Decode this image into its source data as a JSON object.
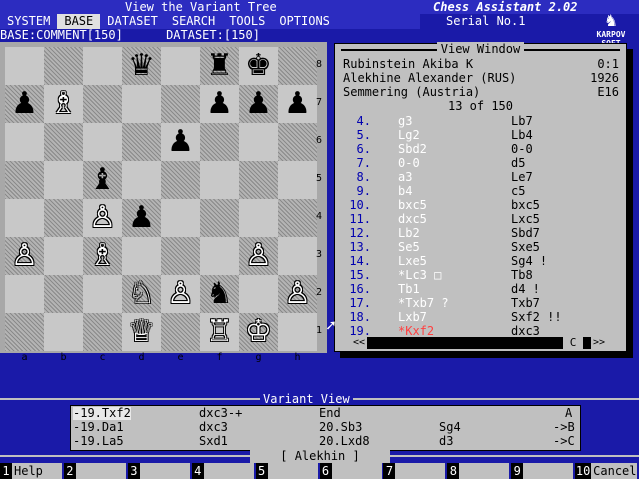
{
  "app": {
    "title": "View the Variant Tree",
    "product": "Chess Assistant 2.02",
    "serial": "Serial No.1",
    "logo_line1": "KARPOV",
    "logo_line2": "SOFT"
  },
  "menu": [
    "SYSTEM",
    "BASE",
    "DATASET",
    "SEARCH",
    "TOOLS",
    "OPTIONS"
  ],
  "menu_active": "BASE",
  "subheader": {
    "base": "BASE:COMMENT[150]",
    "dataset": "DATASET:[150]"
  },
  "board": {
    "files": [
      "a",
      "b",
      "c",
      "d",
      "e",
      "f",
      "g",
      "h"
    ],
    "ranks": [
      "8",
      "7",
      "6",
      "5",
      "4",
      "3",
      "2",
      "1"
    ],
    "pieces": [
      {
        "sq": "d8",
        "p": "♛",
        "c": "b"
      },
      {
        "sq": "f8",
        "p": "♜",
        "c": "b"
      },
      {
        "sq": "g8",
        "p": "♚",
        "c": "b"
      },
      {
        "sq": "a7",
        "p": "♟",
        "c": "b"
      },
      {
        "sq": "b7",
        "p": "♗",
        "c": "w"
      },
      {
        "sq": "f7",
        "p": "♟",
        "c": "b"
      },
      {
        "sq": "g7",
        "p": "♟",
        "c": "b"
      },
      {
        "sq": "h7",
        "p": "♟",
        "c": "b"
      },
      {
        "sq": "e6",
        "p": "♟",
        "c": "b"
      },
      {
        "sq": "c5",
        "p": "♝",
        "c": "b"
      },
      {
        "sq": "c4",
        "p": "♙",
        "c": "w"
      },
      {
        "sq": "d4",
        "p": "♟",
        "c": "b"
      },
      {
        "sq": "a3",
        "p": "♙",
        "c": "w"
      },
      {
        "sq": "c3",
        "p": "♗",
        "c": "w"
      },
      {
        "sq": "g3",
        "p": "♙",
        "c": "w"
      },
      {
        "sq": "d2",
        "p": "♘",
        "c": "w"
      },
      {
        "sq": "e2",
        "p": "♙",
        "c": "w"
      },
      {
        "sq": "f2",
        "p": "♞",
        "c": "b"
      },
      {
        "sq": "h2",
        "p": "♙",
        "c": "w"
      },
      {
        "sq": "d1",
        "p": "♕",
        "c": "w"
      },
      {
        "sq": "f1",
        "p": "♖",
        "c": "w"
      },
      {
        "sq": "g1",
        "p": "♔",
        "c": "w"
      }
    ]
  },
  "view_window": {
    "title": "View Window",
    "white": "Rubinstein Akiba K",
    "result": "0:1",
    "black": "Alekhine Alexander (RUS)",
    "year": "1926",
    "event": "Semmering (Austria)",
    "eco": "E16",
    "counter": "13 of 150",
    "moves": [
      {
        "n": "4.",
        "w": "g3",
        "b": "Lb7"
      },
      {
        "n": "5.",
        "w": "Lg2",
        "b": "Lb4"
      },
      {
        "n": "6.",
        "w": "Sbd2",
        "b": "0-0"
      },
      {
        "n": "7.",
        "w": "0-0",
        "b": "d5"
      },
      {
        "n": "8.",
        "w": "a3",
        "b": "Le7"
      },
      {
        "n": "9.",
        "w": "b4",
        "b": "c5"
      },
      {
        "n": "10.",
        "w": "bxc5",
        "b": "bxc5"
      },
      {
        "n": "11.",
        "w": "dxc5",
        "b": "Lxc5"
      },
      {
        "n": "12.",
        "w": "Lb2",
        "b": "Sbd7"
      },
      {
        "n": "13.",
        "w": "Se5",
        "b": "Sxe5"
      },
      {
        "n": "14.",
        "w": "Lxe5",
        "b": "Sg4 !"
      },
      {
        "n": "15.",
        "w": "*Lc3 □",
        "b": "Tb8"
      },
      {
        "n": "16.",
        "w": "Tb1",
        "b": "d4 !"
      },
      {
        "n": "17.",
        "w": "*Txb7 ?",
        "b": "Txb7"
      },
      {
        "n": "18.",
        "w": "Lxb7",
        "b": "Sxf2 !!"
      },
      {
        "n": "19.",
        "w": "*Kxf2",
        "b": "dxc3"
      }
    ],
    "highlight_color": "#ff4040",
    "scroll_left": "<<",
    "scroll_mid": "C",
    "scroll_right": ">>"
  },
  "variant_view": {
    "title": "Variant View",
    "rows": [
      [
        "-19.Txf2",
        "dxc3-+",
        "End",
        "",
        "A"
      ],
      [
        "-19.Da1",
        "dxc3",
        "20.Sb3",
        "Sg4",
        "->B"
      ],
      [
        "-19.La5",
        "Sxd1",
        "20.Lxd8",
        "d3",
        "->C"
      ]
    ]
  },
  "opening": "[ Alekhin ]",
  "fkeys": [
    {
      "n": "1",
      "l": "Help"
    },
    {
      "n": "2",
      "l": ""
    },
    {
      "n": "3",
      "l": ""
    },
    {
      "n": "4",
      "l": ""
    },
    {
      "n": "5",
      "l": ""
    },
    {
      "n": "6",
      "l": ""
    },
    {
      "n": "7",
      "l": ""
    },
    {
      "n": "8",
      "l": ""
    },
    {
      "n": "9",
      "l": ""
    },
    {
      "n": "10",
      "l": "Cancel"
    }
  ]
}
